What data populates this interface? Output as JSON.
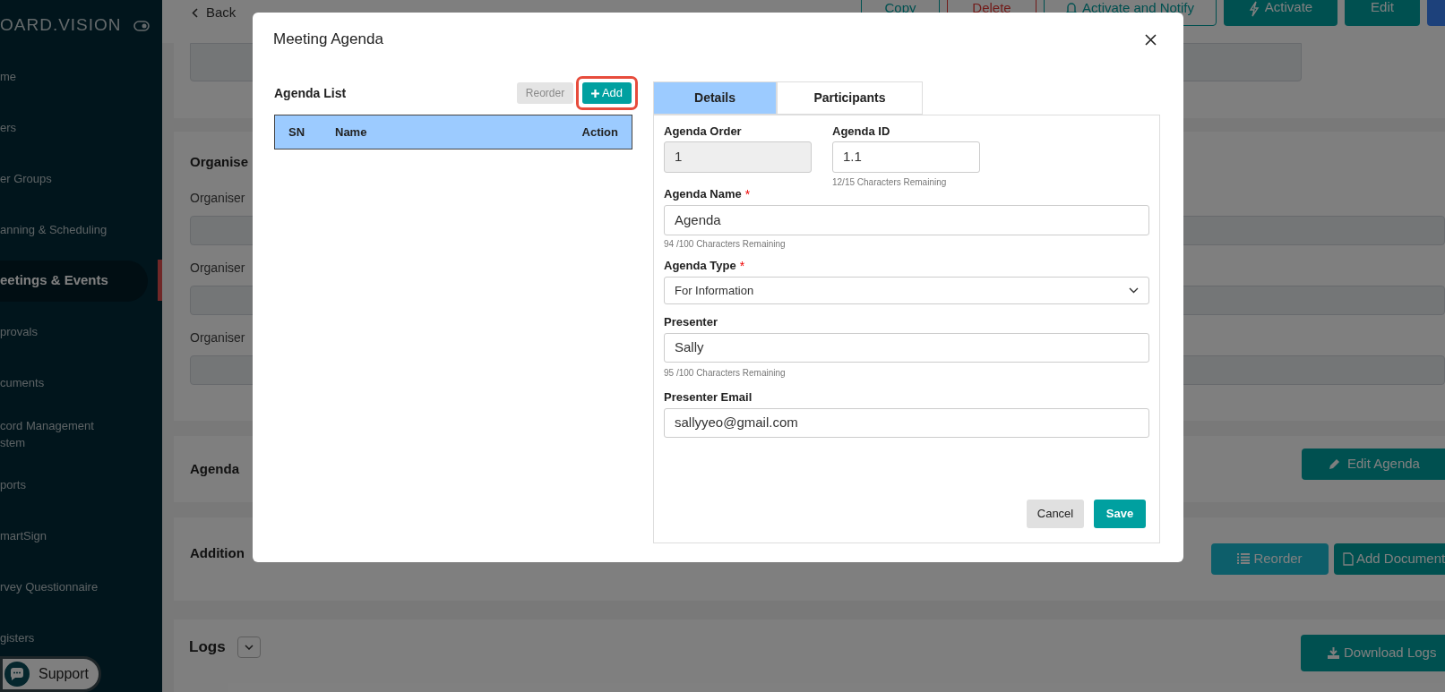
{
  "sidebar": {
    "logo": "OARD.VISION",
    "items": [
      {
        "label": "me",
        "selected": false
      },
      {
        "label": "ers",
        "selected": false
      },
      {
        "label": "er Groups",
        "selected": false
      },
      {
        "label": "anning & Scheduling",
        "selected": false
      },
      {
        "label": "eetings & Events",
        "selected": true
      },
      {
        "label": "provals",
        "selected": false
      },
      {
        "label": "cuments",
        "selected": false
      },
      {
        "label": "cord Management stem",
        "selected": false
      },
      {
        "label": "ports",
        "selected": false
      },
      {
        "label": "martSign",
        "selected": false
      },
      {
        "label": "rvey Questionnaire",
        "selected": false
      },
      {
        "label": "gisters",
        "selected": false
      }
    ],
    "support": "Support"
  },
  "header": {
    "back": "Back",
    "buttons": [
      {
        "label": "Copy",
        "kind": "outline"
      },
      {
        "label": "Delete",
        "kind": "danger"
      },
      {
        "label": "Activate and Notify",
        "kind": "outline"
      },
      {
        "label": "Activate",
        "kind": "solid"
      },
      {
        "label": "Edit",
        "kind": "solid"
      }
    ]
  },
  "organiser": {
    "title": "Organise",
    "labels": [
      "Organiser",
      "Organiser",
      "Organiser"
    ]
  },
  "agenda_section": {
    "title": "Agenda",
    "button": "Edit Agenda"
  },
  "additional_section": {
    "title": "Addition",
    "buttons": [
      "Reorder",
      "Add Document"
    ]
  },
  "logs_section": {
    "title": "Logs",
    "button": "Download Logs"
  },
  "modal": {
    "title": "Meeting Agenda",
    "list": {
      "title": "Agenda List",
      "reorder": {
        "label": "Reorder",
        "disabled": true
      },
      "add": {
        "label": "Add",
        "highlighted": true
      },
      "columns": [
        "SN",
        "Name",
        "Action"
      ]
    },
    "tabs": [
      {
        "label": "Details",
        "selected": true
      },
      {
        "label": "Participants",
        "selected": false
      }
    ],
    "fields": [
      {
        "label": "Agenda Order",
        "kind": "text",
        "value": "1",
        "disabled": true
      },
      {
        "label": "Agenda ID",
        "kind": "text",
        "value": "1.1",
        "disabled": false,
        "hint": "12/15 Characters Remaining"
      },
      {
        "label": "Agenda Name",
        "required_mark": "*",
        "kind": "text",
        "value": "Agenda",
        "disabled": false,
        "hint": "94 /100 Characters Remaining"
      },
      {
        "label": "Agenda Type",
        "required_mark": "*",
        "kind": "select",
        "value": "For Information",
        "disabled": false
      },
      {
        "label": "Presenter",
        "kind": "text",
        "value": "Sally",
        "disabled": false,
        "hint": "95 /100 Characters Remaining"
      },
      {
        "label": "Presenter Email",
        "kind": "text",
        "value": "sallyyeo@gmail.com",
        "disabled": false
      }
    ],
    "cancel": "Cancel",
    "save": "Save"
  }
}
